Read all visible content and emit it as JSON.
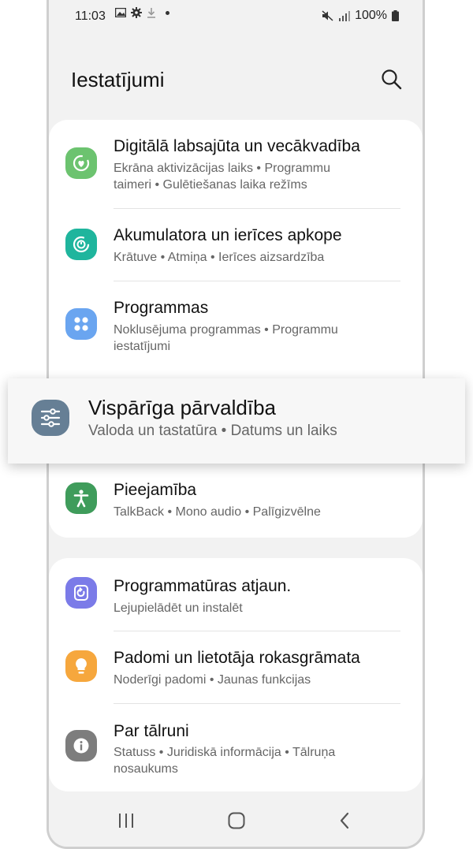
{
  "status_bar": {
    "time": "11:03",
    "battery": "100%"
  },
  "header": {
    "title": "Iestatījumi"
  },
  "items": [
    {
      "name": "Digitālā labsajūta un vecākvadība",
      "sub": "Ekrāna aktivizācijas laiks  •  Programmu taimeri  •  Gulētiešanas laika režīms",
      "icon": "digital-wellbeing-icon",
      "color": "#6cc36f"
    },
    {
      "name": "Akumulatora un ierīces apkope",
      "sub": "Krātuve  •  Atmiņa  •  Ierīces aizsardzība",
      "icon": "device-care-icon",
      "color": "#1fb59d"
    },
    {
      "name": "Programmas",
      "sub": "Noklusējuma programmas  •  Programmu iestatījumi",
      "icon": "apps-icon",
      "color": "#6aa5f0"
    },
    {
      "name": "Pieejamība",
      "sub": "TalkBack  •  Mono audio  •  Palīgizvēlne",
      "icon": "accessibility-icon",
      "color": "#3f9c5b"
    },
    {
      "name": "Programmatūras atjaun.",
      "sub": "Lejupielādēt un instalēt",
      "icon": "software-update-icon",
      "color": "#7b7be8"
    },
    {
      "name": "Padomi un lietotāja rokasgrāmata",
      "sub": "Noderīgi padomi  •  Jaunas funkcijas",
      "icon": "tips-icon",
      "color": "#f6a73d"
    },
    {
      "name": "Par tālruni",
      "sub": "Statuss  •  Juridiskā informācija  •  Tālruņa nosaukums",
      "icon": "info-icon",
      "color": "#7d7d7d"
    }
  ],
  "highlight": {
    "name": "Vispārīga pārvaldība",
    "sub": "Valoda un tastatūra  •  Datums un laiks",
    "icon": "general-management-icon",
    "color": "#667f95"
  }
}
